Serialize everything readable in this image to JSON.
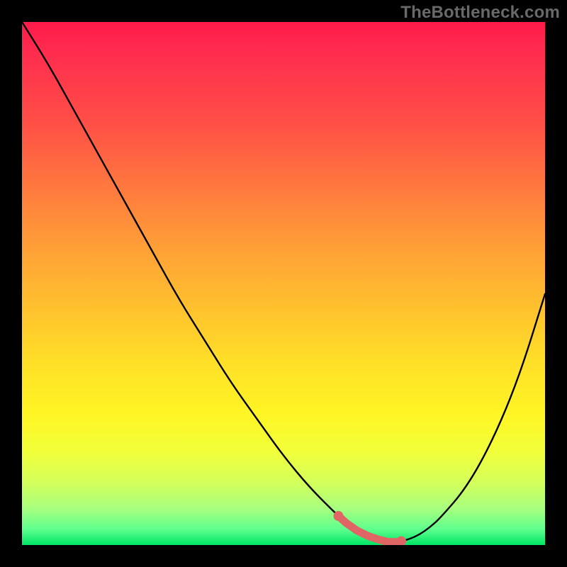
{
  "watermark": "TheBottleneck.com",
  "colors": {
    "curve": "#000000",
    "highlight": "#e06666",
    "frame": "#000000"
  },
  "chart_data": {
    "type": "line",
    "title": "",
    "xlabel": "",
    "ylabel": "",
    "xlim": [
      0,
      100
    ],
    "ylim": [
      0,
      100
    ],
    "x": [
      0,
      5,
      10,
      15,
      20,
      25,
      30,
      35,
      40,
      45,
      50,
      55,
      60,
      62,
      64,
      66,
      68,
      70,
      72,
      74,
      76,
      78,
      80,
      85,
      90,
      95,
      100
    ],
    "y": [
      100,
      92,
      83,
      74,
      65,
      56,
      47,
      39,
      31,
      24,
      17,
      11,
      6,
      4.2,
      2.8,
      1.8,
      1.1,
      0.6,
      0.6,
      1.1,
      2.0,
      3.4,
      5.2,
      11,
      20,
      32,
      48
    ],
    "highlight_range_x": [
      60.5,
      72.5
    ],
    "notes": "y represents bottleneck percentage (0 = optimal). Curve descends sharply from top-left, reaches ~0 around x≈70, then rises again toward the right. No axis ticks or numeric labels are rendered in the source image; values are estimated from curve geometry."
  }
}
